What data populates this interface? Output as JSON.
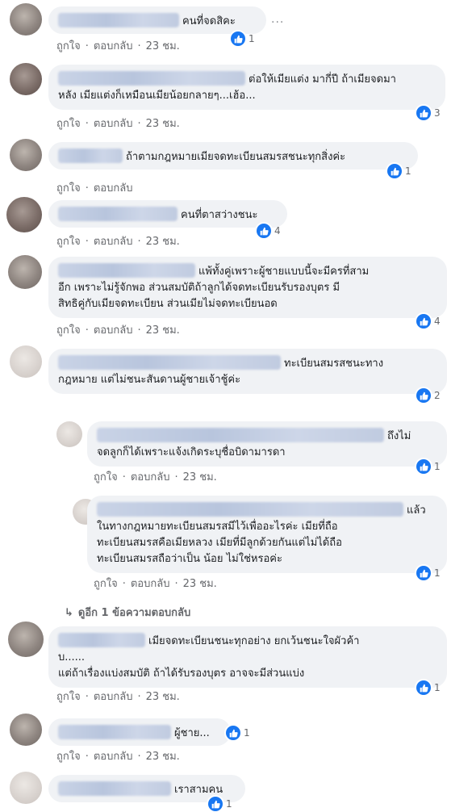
{
  "actions": {
    "like": "ถูกใจ",
    "reply": "ตอบกลับ",
    "sep": "·",
    "more": "···"
  },
  "colors": {
    "like_blue": "#1877f2",
    "bubble_bg": "#f0f2f5",
    "meta_grey": "#65676b"
  },
  "comments": [
    {
      "name_hidden": true,
      "text": "คนที่จดสิคะ",
      "reactions": "1",
      "time": "23 ชม."
    },
    {
      "name_hidden": true,
      "text": "ต่อให้เมียแต่ง มากี่ปี ถ้าเมียจดมา\nหลัง เมียแต่งก็เหมือนเมียน้อยกลายๆ...เฮ้อ...",
      "reactions": "3",
      "time": "23 ชม."
    },
    {
      "name_hidden": true,
      "text": "ถ้าตามกฎหมายเมียจดทะเบียนสมรสชนะทุกสิ่งค่ะ",
      "reactions": "1",
      "time": ""
    },
    {
      "name_hidden": true,
      "text": "คนที่ตาสว่างชนะ",
      "reactions": "4",
      "time": "23 ชม."
    },
    {
      "name_hidden": true,
      "text": "แพ้ทั้งคู่เพราะผู้ชายแบบนี้จะมีครที่สาม\nอีก เพราะไม่รู้จักพอ ส่วนสมบัติถ้าลูกได้จดทะเบียนรับรองบุตร มี\nสิทธิคู่กับเมียจดทะเบียน ส่วนเมียไม่จดทะเบียนอด",
      "reactions": "4",
      "time": "23 ชม."
    },
    {
      "name_hidden": true,
      "text": "ทะเบียนสมรสชนะทาง\nกฎหมาย แต่ไม่ชนะสันดานผู้ชายเจ้าชู้ค่ะ",
      "reactions": "2",
      "time": ""
    },
    {
      "name_hidden": true,
      "text": "ถึงไม่\nจดลูกก็ได้เพราะแจ้งเกิดระบุชื่อบิดามารดา",
      "reactions": "1",
      "time": "23 ชม."
    },
    {
      "name_hidden": true,
      "text": "แล้ว\nในทางกฎหมายทะเบียนสมรสมีไว้เพื่ออะไรค่ะ เมียที่ถือ\nทะเบียนสมรสคือเมียหลวง เมียที่มีลูกด้วยกันแต่ไม่ได้ถือ\nทะเบียนสมรสถือว่าเป็น น้อย ไม่ใช่หรอค่ะ",
      "reactions": "1",
      "time": "23 ชม."
    },
    {
      "name_hidden": true,
      "text": "เมียจดทะเบียนชนะทุกอย่าง ยกเว้นชนะใจผัวค้า\nบ......\nแต่ถ้าเรื่องแบ่งสมบัติ ถ้าได้รับรองบุตร อาจจะมีส่วนแบ่ง",
      "reactions": "1",
      "time": "23 ชม."
    },
    {
      "name_hidden": true,
      "text": "ผู้ชาย...",
      "reactions": "1",
      "time": "23 ชม."
    },
    {
      "name_hidden": true,
      "text": "เราสามคน",
      "reactions": "1",
      "time": ""
    }
  ],
  "view_more_replies": "ดูอีก 1 ข้อความตอบกลับ"
}
